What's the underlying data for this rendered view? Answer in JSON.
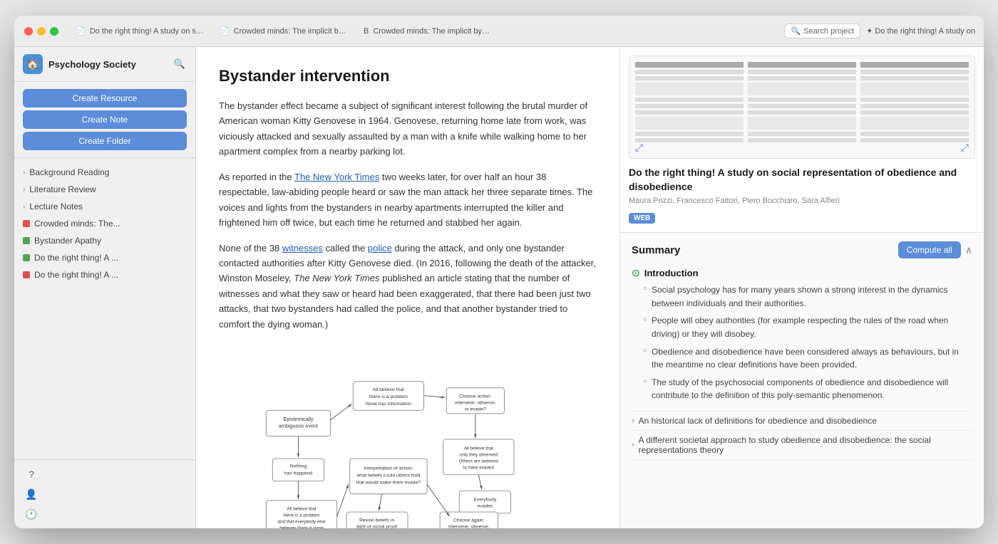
{
  "window": {
    "title": "Psychology Society"
  },
  "tabs": [
    {
      "id": "tab1",
      "icon": "📄",
      "label": "Do the right thing! A study on social repr...",
      "active": false
    },
    {
      "id": "tab2",
      "icon": "📄",
      "label": "Crowded minds: The implicit bystander e...",
      "active": false
    },
    {
      "id": "tab3",
      "icon": "B",
      "label": "Crowded minds: The implicit bystander e...",
      "active": false
    }
  ],
  "toolbar": {
    "search_placeholder": "Search project",
    "right_label": "✦ Do the right thing! A study on"
  },
  "sidebar": {
    "title": "Psychology Society",
    "logo_icon": "🏠",
    "search_icon": "🔍",
    "actions": [
      {
        "id": "create-resource",
        "label": "Create Resource"
      },
      {
        "id": "create-note",
        "label": "Create Note"
      },
      {
        "id": "create-folder",
        "label": "Create Folder"
      }
    ],
    "nav_items": [
      {
        "id": "background-reading",
        "label": "Background Reading",
        "type": "folder",
        "expanded": false
      },
      {
        "id": "literature-review",
        "label": "Literature Review",
        "type": "folder",
        "expanded": false
      },
      {
        "id": "lecture-notes",
        "label": "Lecture Notes",
        "type": "folder",
        "expanded": false
      },
      {
        "id": "crowded-minds",
        "label": "Crowded minds: The...",
        "type": "file",
        "color": "red"
      },
      {
        "id": "bystander-apathy",
        "label": "Bystander Apathy",
        "type": "file",
        "color": "green"
      },
      {
        "id": "do-right-thing-1",
        "label": "Do the right thing! A ...",
        "type": "file",
        "color": "green"
      },
      {
        "id": "do-right-thing-2",
        "label": "Do the right thing! A ...",
        "type": "file",
        "color": "red"
      }
    ],
    "bottom_icons": [
      "?",
      "👤",
      "🕐"
    ]
  },
  "document": {
    "title": "Bystander intervention",
    "paragraphs": [
      "The bystander effect became a subject of significant interest following the brutal murder of American woman Kitty Genovese in 1964. Genovese, returning home late from work, was viciously attacked and sexually assaulted by a man with a knife while walking home to her apartment complex from a nearby parking lot.",
      "As reported in the The New York Times two weeks later, for over half an hour 38 respectable, law-abiding people heard or saw the man attack her three separate times. The voices and lights from the bystanders in nearby apartments interrupted the killer and frightened him off twice, but each time he returned and stabbed her again.",
      "None of the 38 witnesses called the police during the attack, and only one bystander contacted authorities after Kitty Genovese died. (In 2016, following the death of the attacker, Winston Moseley, The New York Times published an article stating that the number of witnesses and what they saw or heard had been exaggerated, that there had been just two attacks, that two bystanders had called the police, and that another bystander tried to comfort the dying woman.)"
    ],
    "nyt_link": "The New York Times",
    "witnesses_link": "witnesses",
    "police_link": "police"
  },
  "right_panel": {
    "paper": {
      "title": "Do the right thing! A study on social representation of obedience and disobedience",
      "authors": "Maura Pozzi, Francesco Fattori, Piero Bocchiaro, Sara Alfieri",
      "badge": "WEB"
    },
    "summary": {
      "title": "Summary",
      "compute_btn": "Compute all",
      "sections": [
        {
          "id": "introduction",
          "label": "Introduction",
          "status": "done",
          "bullets": [
            "Social psychology has for many years shown a strong interest in the dynamics between individuals and their authorities.",
            "People will obey authorities (for example respecting the rules of the road when driving) or they will disobey.",
            "Obedience and disobedience have been considered always as behaviours, but in the meantime no clear definitions have been provided.",
            "The study of the psychosocial components of obedience and disobedience will contribute to the definition of this poly-semantic phenomenon."
          ]
        },
        {
          "id": "historical-lack",
          "label": "An historical lack of definitions for obedience and disobedience",
          "status": "collapsed"
        },
        {
          "id": "societal-approach",
          "label": "A different societal approach to study obedience and disobedience: the social representations theory",
          "status": "collapsed"
        }
      ]
    }
  }
}
